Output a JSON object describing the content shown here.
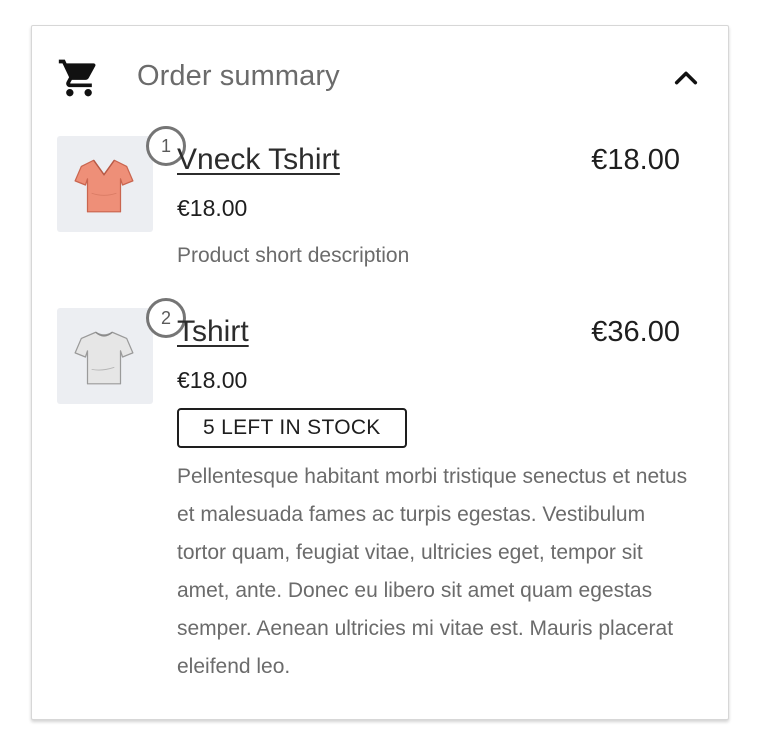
{
  "header": {
    "icon": "shopping-cart-icon",
    "title": "Order summary",
    "toggle_icon": "chevron-up-icon"
  },
  "items": [
    {
      "quantity": "1",
      "name": "Vneck Tshirt",
      "total": "€18.00",
      "unit_price": "€18.00",
      "description": "Product short description",
      "shirt_color": "#ee8f78",
      "thumb_bg": "#eceef2"
    },
    {
      "quantity": "2",
      "name": "Tshirt",
      "total": "€36.00",
      "unit_price": "€18.00",
      "stock_badge": "5 LEFT IN STOCK",
      "description": "Pellentesque habitant morbi tristique senectus et netus et malesuada fames ac turpis egestas. Vestibulum tortor quam, feugiat vitae, ultricies eget, tempor sit amet, ante. Donec eu libero sit amet quam egestas semper. Aenean ultricies mi vitae est. Mauris placerat eleifend leo.",
      "shirt_color": "#e4e4e4",
      "thumb_bg": "#eceef2"
    }
  ]
}
